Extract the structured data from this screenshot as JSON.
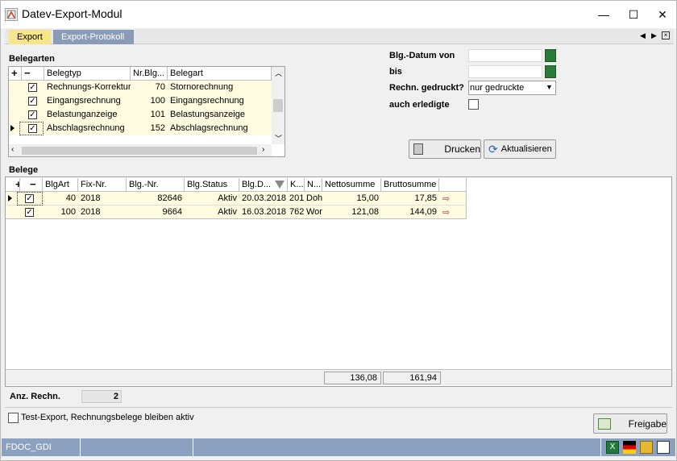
{
  "window": {
    "title": "Datev-Export-Modul",
    "minimize": "—",
    "maximize": "☐",
    "close": "✕"
  },
  "tabs": [
    {
      "label": "Export"
    },
    {
      "label": "Export-Protokoll"
    }
  ],
  "belegarten": {
    "title": "Belegarten",
    "columns": [
      "Belegtyp",
      "Nr.Blg...",
      "Belegart"
    ],
    "rows": [
      {
        "typ": "Rechnungs-Korrektur",
        "nr": "70",
        "art": "Stornorechnung",
        "checked": true
      },
      {
        "typ": "Eingangsrechnung",
        "nr": "100",
        "art": "Eingangsrechnung",
        "checked": true
      },
      {
        "typ": "Belastunganzeige",
        "nr": "101",
        "art": "Belastungsanzeige",
        "checked": true
      },
      {
        "typ": "Abschlagsrechnung",
        "nr": "152",
        "art": "Abschlagsrechnung",
        "checked": true
      }
    ]
  },
  "filter": {
    "datum_von_label": "Blg.-Datum von",
    "bis_label": "bis",
    "gedruckt_label": "Rechn. gedruckt?",
    "gedruckt_value": "nur gedruckte",
    "erledigte_label": "auch erledigte"
  },
  "buttons": {
    "drucken": "Drucken",
    "aktualisieren": "Aktualisieren",
    "freigabe": "Freigabe"
  },
  "belege": {
    "title": "Belege",
    "columns": [
      "BlgArt",
      "Fix-Nr.",
      "Blg.-Nr.",
      "Blg.Status",
      "Blg.D...",
      "K...",
      "N...",
      "Nettosumme",
      "Bruttosumme"
    ],
    "rows": [
      {
        "art": "40",
        "fix": "2018",
        "nr": "82646",
        "status": "Aktiv",
        "datum": "20.03.2018",
        "k": "201",
        "n": "Doh",
        "netto": "15,00",
        "brutto": "17,85"
      },
      {
        "art": "100",
        "fix": "2018",
        "nr": "9664",
        "status": "Aktiv",
        "datum": "16.03.2018",
        "k": "762",
        "n": "Wor",
        "netto": "121,08",
        "brutto": "144,09"
      }
    ],
    "sum_netto": "136,08",
    "sum_brutto": "161,94"
  },
  "anz": {
    "label": "Anz. Rechn.",
    "value": "2"
  },
  "test_export_label": "Test-Export, Rechnungsbelege bleiben aktiv",
  "status": {
    "user": "FDOC_GDI"
  },
  "colors": {
    "accent_tab": "#f7e58a",
    "status_bar": "#8ca0c0",
    "row_highlight": "#fffbe0"
  }
}
